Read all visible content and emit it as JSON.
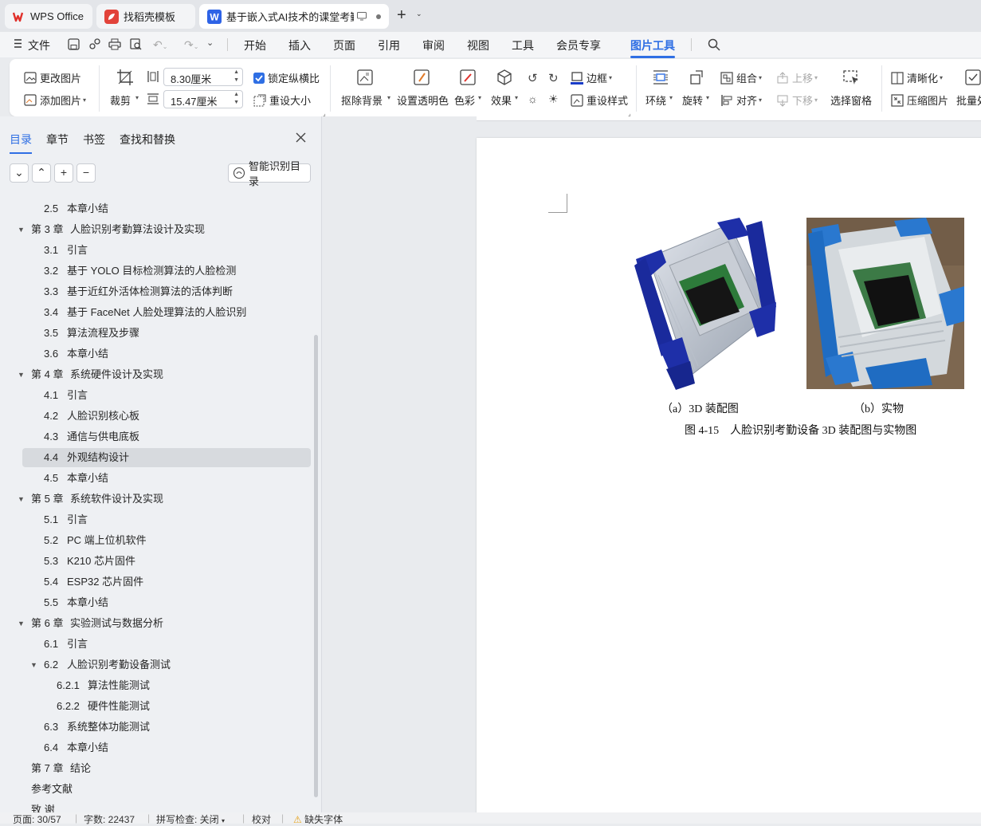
{
  "tabs": [
    {
      "label": "WPS Office"
    },
    {
      "label": "找稻壳模板"
    },
    {
      "label": "基于嵌入式AI技术的课堂考勤系统"
    }
  ],
  "menu": {
    "file": "文件",
    "items": [
      "开始",
      "插入",
      "页面",
      "引用",
      "审阅",
      "视图",
      "工具",
      "会员专享",
      "图片工具"
    ]
  },
  "ribbon": {
    "change_picture": "更改图片",
    "add_picture": "添加图片",
    "crop": "裁剪",
    "width": "8.30厘米",
    "height": "15.47厘米",
    "lock_ratio": "锁定纵横比",
    "reset_size": "重设大小",
    "remove_bg": "抠除背景",
    "set_transparent": "设置透明色",
    "color": "色彩",
    "effects": "效果",
    "border": "边框",
    "reset_style": "重设样式",
    "wrap": "环绕",
    "rotate": "旋转",
    "group": "组合",
    "align": "对齐",
    "bring_forward": "上移",
    "send_backward": "下移",
    "selection_pane": "选择窗格",
    "sharpen": "清晰化",
    "compress": "压缩图片",
    "batch": "批量处"
  },
  "sidebar": {
    "tabs": [
      "目录",
      "章节",
      "书签",
      "查找和替换"
    ],
    "smart_toc": "智能识别目录",
    "toc": [
      {
        "num": "2.5",
        "title": "本章小结",
        "level": 2
      },
      {
        "num": "第 3 章",
        "title": "人脸识别考勤算法设计及实现",
        "level": 1
      },
      {
        "num": "3.1",
        "title": "引言",
        "level": 2
      },
      {
        "num": "3.2",
        "title": "基于 YOLO 目标检测算法的人脸检测",
        "level": 2
      },
      {
        "num": "3.3",
        "title": "基于近红外活体检测算法的活体判断",
        "level": 2
      },
      {
        "num": "3.4",
        "title": "基于 FaceNet 人脸处理算法的人脸识别",
        "level": 2
      },
      {
        "num": "3.5",
        "title": "算法流程及步骤",
        "level": 2
      },
      {
        "num": "3.6",
        "title": "本章小结",
        "level": 2
      },
      {
        "num": "第 4 章",
        "title": "系统硬件设计及实现",
        "level": 1
      },
      {
        "num": "4.1",
        "title": "引言",
        "level": 2
      },
      {
        "num": "4.2",
        "title": "人脸识别核心板",
        "level": 2
      },
      {
        "num": "4.3",
        "title": "通信与供电底板",
        "level": 2
      },
      {
        "num": "4.4",
        "title": "外观结构设计",
        "level": 2
      },
      {
        "num": "4.5",
        "title": "本章小结",
        "level": 2
      },
      {
        "num": "第 5 章",
        "title": "系统软件设计及实现",
        "level": 1
      },
      {
        "num": "5.1",
        "title": "引言",
        "level": 2
      },
      {
        "num": "5.2",
        "title": "PC 端上位机软件",
        "level": 2
      },
      {
        "num": "5.3",
        "title": "K210 芯片固件",
        "level": 2
      },
      {
        "num": "5.4",
        "title": "ESP32 芯片固件",
        "level": 2
      },
      {
        "num": "5.5",
        "title": "本章小结",
        "level": 2
      },
      {
        "num": "第 6 章",
        "title": "实验测试与数据分析",
        "level": 1
      },
      {
        "num": "6.1",
        "title": "引言",
        "level": 2
      },
      {
        "num": "6.2",
        "title": "人脸识别考勤设备测试",
        "level": 2
      },
      {
        "num": "6.2.1",
        "title": "算法性能测试",
        "level": 3
      },
      {
        "num": "6.2.2",
        "title": "硬件性能测试",
        "level": 3
      },
      {
        "num": "6.3",
        "title": "系统整体功能测试",
        "level": 2
      },
      {
        "num": "6.4",
        "title": "本章小结",
        "level": 2
      },
      {
        "num": "第 7 章",
        "title": "结论",
        "level": 1
      },
      {
        "num": "参考文献",
        "title": "",
        "level": 1
      },
      {
        "num": "致 谢",
        "title": "",
        "level": 1
      }
    ]
  },
  "document": {
    "caption_a": "（a）3D 装配图",
    "caption_b": "（b）实物",
    "figure_caption": "图 4-15　人脸识别考勤设备 3D 装配图与实物图"
  },
  "status": {
    "page": "页面: 30/57",
    "words": "字数: 22437",
    "spell": "拼写检查: 关闭",
    "proof": "校对",
    "missing_font": "缺失字体"
  }
}
